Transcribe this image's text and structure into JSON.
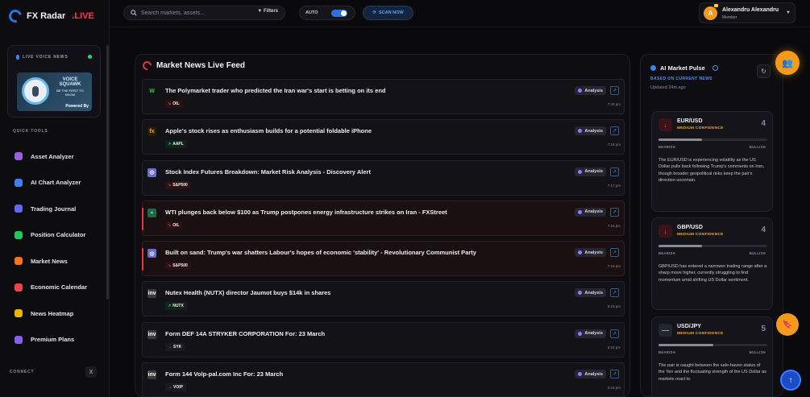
{
  "brand": {
    "name": "FX Radar",
    "live": ".LIVE"
  },
  "voice": {
    "header": "LIVE VOICE NEWS",
    "ad_title": "VOICE SQUAWK",
    "ad_sub": "BE THE FIRST TO KNOW",
    "ad_powered": "Powered By"
  },
  "sidebar": {
    "section_label": "QUICK TOOLS",
    "items": [
      {
        "label": "Asset Analyzer",
        "icon": "asset-analyzer-icon",
        "color": "#9b5de5"
      },
      {
        "label": "AI Chart Analyzer",
        "icon": "ai-chart-icon",
        "color": "#3b82f6"
      },
      {
        "label": "Trading Journal",
        "icon": "journal-icon",
        "color": "#6366f1"
      },
      {
        "label": "Position Calculator",
        "icon": "calculator-icon",
        "color": "#22c55e"
      },
      {
        "label": "Market News",
        "icon": "news-icon",
        "color": "#f97316"
      },
      {
        "label": "Economic Calendar",
        "icon": "calendar-icon",
        "color": "#ef4444"
      },
      {
        "label": "News Heatmap",
        "icon": "heatmap-icon",
        "color": "#eab308"
      },
      {
        "label": "Premium Plans",
        "icon": "crown-icon",
        "color": "#8b5cf6"
      }
    ],
    "connect_label": "CONNECT",
    "x_label": "X"
  },
  "topbar": {
    "search_placeholder": "Search markets, assets...",
    "filters_label": "Filters",
    "auto_label": "AUTO",
    "scan_label": "SCAN NOW"
  },
  "user": {
    "initial": "A",
    "name": "Alexandru Alexandru",
    "role": "Member"
  },
  "feed": {
    "title": "Market News Live Feed",
    "analysis_label": "Analysis",
    "items": [
      {
        "title": "The Polymarket trader who predicted the Iran war's start is betting on its end",
        "ticker": "OIL",
        "dir": "down",
        "time": "7:20 pm",
        "alert": false,
        "source_icon": "W",
        "source_color": "#2ecc40",
        "source_bg": "transparent"
      },
      {
        "title": "Apple's stock rises as enthusiasm builds for a potential foldable iPhone",
        "ticker": "AAPL",
        "dir": "up",
        "time": "7:18 pm",
        "alert": false,
        "source_icon": "fx",
        "source_color": "#f5a623",
        "source_bg": "#2a1d08"
      },
      {
        "title": "Stock Index Futures Breakdown: Market Risk Analysis - Discovery Alert",
        "ticker": "S&P500",
        "dir": "down",
        "time": "7:17 pm",
        "alert": false,
        "source_icon": "◎",
        "source_color": "#ffffff",
        "source_bg": "#6b6bd6"
      },
      {
        "title": "WTI plunges back below $100 as Trump postpones energy infrastructure strikes on Iran - FXStreet",
        "ticker": "OIL",
        "dir": "down",
        "time": "7:16 pm",
        "alert": true,
        "source_icon": "●",
        "source_color": "#4ac0ff",
        "source_bg": "#1d6a3a"
      },
      {
        "title": "Built on sand: Trump's war shatters Labour's hopes of economic 'stability' - Revolutionary Communist Party",
        "ticker": "S&P500",
        "dir": "down",
        "time": "7:16 pm",
        "alert": true,
        "source_icon": "◎",
        "source_color": "#ffffff",
        "source_bg": "#6b6bd6"
      },
      {
        "title": "Nutex Health (NUTX) director Jaumot buys $14k in shares",
        "ticker": "NUTX",
        "dir": "up",
        "time": "5:16 pm",
        "alert": false,
        "source_icon": "inv",
        "source_color": "#ffffff",
        "source_bg": "#3a3a3a"
      },
      {
        "title": "Form DEF 14A STRYKER CORPORATION For: 23 March",
        "ticker": "SYK",
        "dir": "flat",
        "time": "5:15 pm",
        "alert": false,
        "source_icon": "inv",
        "source_color": "#ffffff",
        "source_bg": "#3a3a3a"
      },
      {
        "title": "Form 144 Volp-pal.com Inc For: 23 March",
        "ticker": "VOIP",
        "dir": "flat",
        "time": "5:15 pm",
        "alert": false,
        "source_icon": "inv",
        "source_color": "#ffffff",
        "source_bg": "#3a3a3a"
      }
    ]
  },
  "pulse": {
    "title": "AI Market Pulse",
    "based_on": "BASED ON CURRENT NEWS",
    "updated": "Updated 24m ago",
    "bearish_label": "BEARISH",
    "bullish_label": "BULLISH",
    "cards": [
      {
        "pair": "EUR/USD",
        "confidence": "MEDIUM CONFIDENCE",
        "score": "4",
        "dir": "down",
        "bar": 0.4,
        "text": "The EUR/USD is experiencing volatility as the US Dollar pulls back following Trump's comments on Iran, though broader geopolitical risks keep the pair's direction uncertain."
      },
      {
        "pair": "GBP/USD",
        "confidence": "MEDIUM CONFIDENCE",
        "score": "4",
        "dir": "down",
        "bar": 0.4,
        "text": "GBP/USD has entered a narrower trading range after a sharp move higher, currently struggling to find momentum amid shifting US Dollar sentiment."
      },
      {
        "pair": "USD/JPY",
        "confidence": "MEDIUM CONFIDENCE",
        "score": "5",
        "dir": "flat",
        "bar": 0.5,
        "text": "The pair is caught between the safe-haven status of the Yen and the fluctuating strength of the US Dollar as markets react to"
      }
    ]
  }
}
